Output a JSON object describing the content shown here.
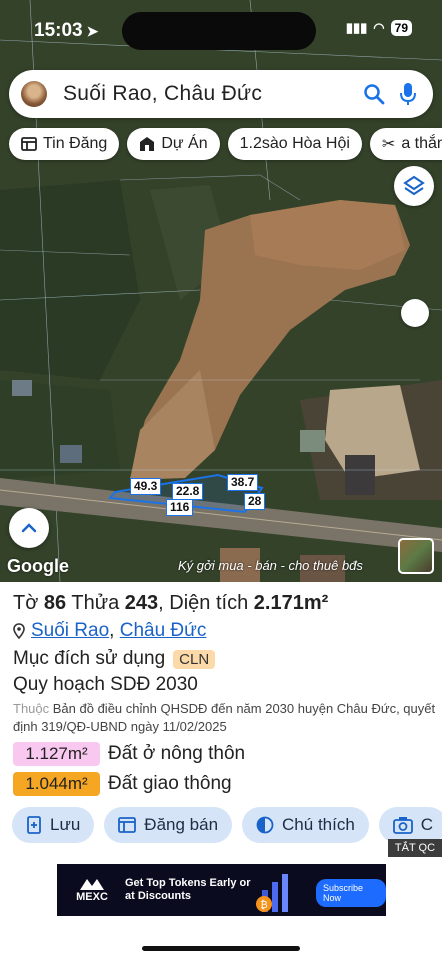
{
  "status": {
    "time": "15:03",
    "battery": "79"
  },
  "search": {
    "query": "Suối Rao, Châu Đức"
  },
  "chips": [
    {
      "label": "Tin Đăng",
      "icon": "list-icon"
    },
    {
      "label": "Dự Án",
      "icon": "building-icon"
    },
    {
      "label": "1.2sào Hòa Hội",
      "icon": ""
    },
    {
      "label": "a thắng",
      "icon": "tools-icon"
    }
  ],
  "map": {
    "dimensions": [
      "49.3",
      "22.8",
      "38.7",
      "28",
      "116"
    ],
    "google_label": "Google",
    "watermark": "Ký gởi mua - bán - cho thuê bđs"
  },
  "parcel": {
    "to_label": "Tờ",
    "to_value": "86",
    "thua_label": "Thửa",
    "thua_value": "243",
    "area_label": ", Diện tích",
    "area_value": "2.171m²",
    "location_commune": "Suối Rao",
    "location_sep": ",",
    "location_district": "Châu Đức",
    "purpose_label": "Mục đích sử dụng",
    "purpose_code": "CLN",
    "plan_title": "Quy hoạch SDĐ 2030",
    "plan_note_prefix": "Thuộc",
    "plan_note": "Bản đồ điều chỉnh QHSDĐ đến năm 2030 huyện Châu Đức, quyết định 319/QĐ-UBND ngày 11/02/2025"
  },
  "land_use": [
    {
      "value": "1.127m²",
      "label": "Đất ở nông thôn",
      "color": "#f9c8f0"
    },
    {
      "value": "1.044m²",
      "label": "Đất giao thông",
      "color": "#f5a623"
    }
  ],
  "actions": [
    {
      "label": "Lưu",
      "icon": "bookmark-plus-icon"
    },
    {
      "label": "Đăng bán",
      "icon": "listing-icon"
    },
    {
      "label": "Chú thích",
      "icon": "contrast-icon"
    },
    {
      "label": "C",
      "icon": "camera-icon"
    }
  ],
  "tat_qc": "TẮT QC",
  "ad": {
    "brand": "MEXC",
    "headline": "Get Top Tokens Early or at Discounts",
    "cta": "Subscribe Now"
  },
  "colors": {
    "accent": "#1a73e8",
    "link": "#1a63c8",
    "action_bg": "#d6e4f7"
  }
}
